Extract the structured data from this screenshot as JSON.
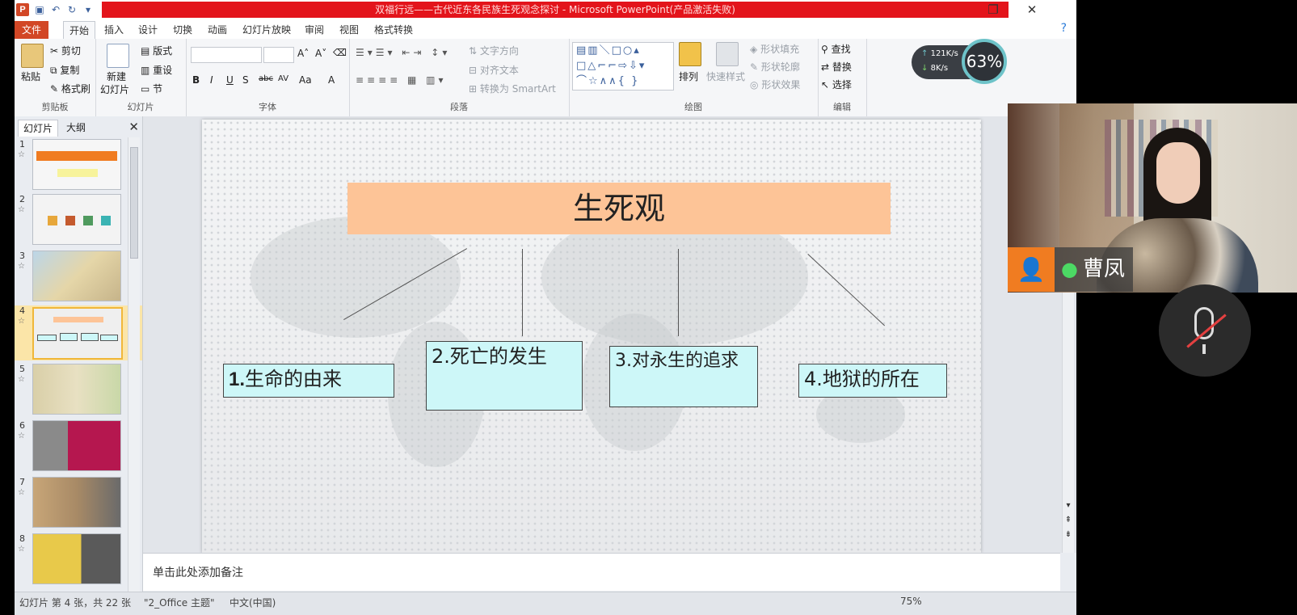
{
  "window": {
    "title": "双福行远——古代近东各民族生死观念探讨 - Microsoft PowerPoint(产品激活失败)",
    "restore_glyph": "❐",
    "close_glyph": "✕"
  },
  "ribbon_tabs": [
    "文件",
    "开始",
    "插入",
    "设计",
    "切换",
    "动画",
    "幻灯片放映",
    "审阅",
    "视图",
    "格式转换"
  ],
  "ribbon": {
    "clipboard": {
      "paste": "粘贴",
      "cut": "剪切",
      "copy": "复制",
      "format_painter": "格式刷",
      "label": "剪贴板"
    },
    "slides": {
      "new_slide": "新建",
      "new_slide2": "幻灯片",
      "layout": "版式",
      "reset": "重设",
      "section": "节",
      "label": "幻灯片"
    },
    "font": {
      "label": "字体",
      "bold": "B",
      "italic": "I",
      "underline": "U",
      "shadow": "S",
      "strike": "abc",
      "spacing": "AV",
      "case": "Aa",
      "color": "A"
    },
    "paragraph": {
      "text_direction": "文字方向",
      "align_text": "对齐文本",
      "convert_smartart": "转换为 SmartArt",
      "label": "段落"
    },
    "drawing": {
      "arrange": "排列",
      "quick_styles": "快速样式",
      "shape_fill": "形状填充",
      "shape_outline": "形状轮廓",
      "shape_effects": "形状效果",
      "label": "绘图"
    },
    "editing": {
      "find": "查找",
      "replace": "替换",
      "select": "选择",
      "label": "编辑"
    }
  },
  "net_widget": {
    "up": "121K/s",
    "down": "8K/s",
    "percent": "63%"
  },
  "panel": {
    "tab_slides": "幻灯片",
    "tab_outline": "大纲",
    "close": "✕"
  },
  "thumbnails": [
    {
      "num": "1"
    },
    {
      "num": "2"
    },
    {
      "num": "3"
    },
    {
      "num": "4"
    },
    {
      "num": "5"
    },
    {
      "num": "6"
    },
    {
      "num": "7"
    },
    {
      "num": "8"
    }
  ],
  "slide": {
    "title": "生死观",
    "boxes": [
      {
        "num": "1.",
        "text": "生命的由来"
      },
      {
        "num": "2.",
        "text": "死亡的发生"
      },
      {
        "num": "3.",
        "text": "对永生的追求"
      },
      {
        "num": "4.",
        "text": "地狱的所在"
      }
    ]
  },
  "notes": {
    "placeholder": "单击此处添加备注"
  },
  "status": {
    "slide_info": "幻灯片 第 4 张，共 22 张",
    "theme": "\"2_Office 主题\"",
    "language": "中文(中国)",
    "zoom": "75%"
  },
  "video": {
    "participant": "曹凤"
  },
  "colors": {
    "title_bar_red": "#e3141b",
    "file_tab": "#d24726",
    "slide_title_fill": "#fdc497",
    "box_fill": "#cdf7f8",
    "avatar_orange": "#f07c21",
    "mic_green": "#4cd964"
  }
}
